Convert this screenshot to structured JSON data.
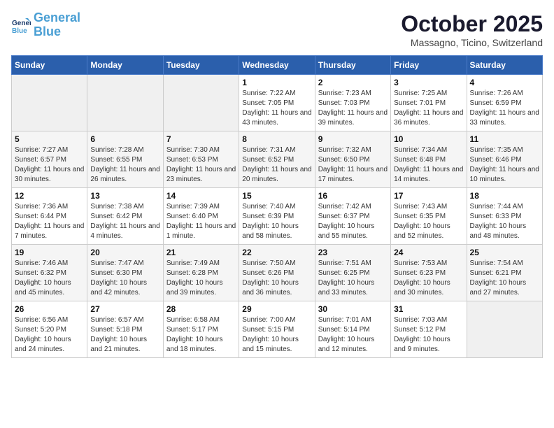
{
  "header": {
    "logo_line1": "General",
    "logo_line2": "Blue",
    "month": "October 2025",
    "location": "Massagno, Ticino, Switzerland"
  },
  "weekdays": [
    "Sunday",
    "Monday",
    "Tuesday",
    "Wednesday",
    "Thursday",
    "Friday",
    "Saturday"
  ],
  "weeks": [
    [
      {
        "day": "",
        "info": ""
      },
      {
        "day": "",
        "info": ""
      },
      {
        "day": "",
        "info": ""
      },
      {
        "day": "1",
        "info": "Sunrise: 7:22 AM\nSunset: 7:05 PM\nDaylight: 11 hours and 43 minutes."
      },
      {
        "day": "2",
        "info": "Sunrise: 7:23 AM\nSunset: 7:03 PM\nDaylight: 11 hours and 39 minutes."
      },
      {
        "day": "3",
        "info": "Sunrise: 7:25 AM\nSunset: 7:01 PM\nDaylight: 11 hours and 36 minutes."
      },
      {
        "day": "4",
        "info": "Sunrise: 7:26 AM\nSunset: 6:59 PM\nDaylight: 11 hours and 33 minutes."
      }
    ],
    [
      {
        "day": "5",
        "info": "Sunrise: 7:27 AM\nSunset: 6:57 PM\nDaylight: 11 hours and 30 minutes."
      },
      {
        "day": "6",
        "info": "Sunrise: 7:28 AM\nSunset: 6:55 PM\nDaylight: 11 hours and 26 minutes."
      },
      {
        "day": "7",
        "info": "Sunrise: 7:30 AM\nSunset: 6:53 PM\nDaylight: 11 hours and 23 minutes."
      },
      {
        "day": "8",
        "info": "Sunrise: 7:31 AM\nSunset: 6:52 PM\nDaylight: 11 hours and 20 minutes."
      },
      {
        "day": "9",
        "info": "Sunrise: 7:32 AM\nSunset: 6:50 PM\nDaylight: 11 hours and 17 minutes."
      },
      {
        "day": "10",
        "info": "Sunrise: 7:34 AM\nSunset: 6:48 PM\nDaylight: 11 hours and 14 minutes."
      },
      {
        "day": "11",
        "info": "Sunrise: 7:35 AM\nSunset: 6:46 PM\nDaylight: 11 hours and 10 minutes."
      }
    ],
    [
      {
        "day": "12",
        "info": "Sunrise: 7:36 AM\nSunset: 6:44 PM\nDaylight: 11 hours and 7 minutes."
      },
      {
        "day": "13",
        "info": "Sunrise: 7:38 AM\nSunset: 6:42 PM\nDaylight: 11 hours and 4 minutes."
      },
      {
        "day": "14",
        "info": "Sunrise: 7:39 AM\nSunset: 6:40 PM\nDaylight: 11 hours and 1 minute."
      },
      {
        "day": "15",
        "info": "Sunrise: 7:40 AM\nSunset: 6:39 PM\nDaylight: 10 hours and 58 minutes."
      },
      {
        "day": "16",
        "info": "Sunrise: 7:42 AM\nSunset: 6:37 PM\nDaylight: 10 hours and 55 minutes."
      },
      {
        "day": "17",
        "info": "Sunrise: 7:43 AM\nSunset: 6:35 PM\nDaylight: 10 hours and 52 minutes."
      },
      {
        "day": "18",
        "info": "Sunrise: 7:44 AM\nSunset: 6:33 PM\nDaylight: 10 hours and 48 minutes."
      }
    ],
    [
      {
        "day": "19",
        "info": "Sunrise: 7:46 AM\nSunset: 6:32 PM\nDaylight: 10 hours and 45 minutes."
      },
      {
        "day": "20",
        "info": "Sunrise: 7:47 AM\nSunset: 6:30 PM\nDaylight: 10 hours and 42 minutes."
      },
      {
        "day": "21",
        "info": "Sunrise: 7:49 AM\nSunset: 6:28 PM\nDaylight: 10 hours and 39 minutes."
      },
      {
        "day": "22",
        "info": "Sunrise: 7:50 AM\nSunset: 6:26 PM\nDaylight: 10 hours and 36 minutes."
      },
      {
        "day": "23",
        "info": "Sunrise: 7:51 AM\nSunset: 6:25 PM\nDaylight: 10 hours and 33 minutes."
      },
      {
        "day": "24",
        "info": "Sunrise: 7:53 AM\nSunset: 6:23 PM\nDaylight: 10 hours and 30 minutes."
      },
      {
        "day": "25",
        "info": "Sunrise: 7:54 AM\nSunset: 6:21 PM\nDaylight: 10 hours and 27 minutes."
      }
    ],
    [
      {
        "day": "26",
        "info": "Sunrise: 6:56 AM\nSunset: 5:20 PM\nDaylight: 10 hours and 24 minutes."
      },
      {
        "day": "27",
        "info": "Sunrise: 6:57 AM\nSunset: 5:18 PM\nDaylight: 10 hours and 21 minutes."
      },
      {
        "day": "28",
        "info": "Sunrise: 6:58 AM\nSunset: 5:17 PM\nDaylight: 10 hours and 18 minutes."
      },
      {
        "day": "29",
        "info": "Sunrise: 7:00 AM\nSunset: 5:15 PM\nDaylight: 10 hours and 15 minutes."
      },
      {
        "day": "30",
        "info": "Sunrise: 7:01 AM\nSunset: 5:14 PM\nDaylight: 10 hours and 12 minutes."
      },
      {
        "day": "31",
        "info": "Sunrise: 7:03 AM\nSunset: 5:12 PM\nDaylight: 10 hours and 9 minutes."
      },
      {
        "day": "",
        "info": ""
      }
    ]
  ]
}
